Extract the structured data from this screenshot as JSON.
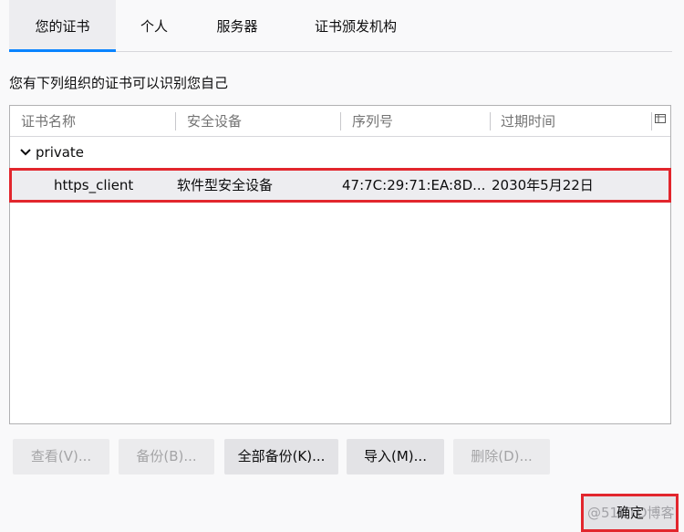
{
  "tabs": [
    {
      "label": "您的证书",
      "selected": true
    },
    {
      "label": "个人",
      "selected": false
    },
    {
      "label": "服务器",
      "selected": false
    },
    {
      "label": "证书颁发机构",
      "selected": false
    }
  ],
  "description": "您有下列组织的证书可以识别您自己",
  "table": {
    "columns": [
      "证书名称",
      "安全设备",
      "序列号",
      "过期时间"
    ],
    "column_picker_icon": "column-picker-icon",
    "group": {
      "label": "private",
      "expanded": true,
      "icon": "chevron-down-icon"
    },
    "rows": [
      {
        "name": "https_client",
        "device": "软件型安全设备",
        "serial": "47:7C:29:71:EA:8D...",
        "expires": "2030年5月22日"
      }
    ]
  },
  "buttons": {
    "view": "查看(V)...",
    "backup": "备份(B)...",
    "backup_all": "全部备份(K)...",
    "import": "导入(M)...",
    "delete": "删除(D)..."
  },
  "ok_button": "确定",
  "watermark": "@51CTO博客",
  "colors": {
    "accent": "#0a84ff",
    "highlight": "#e2262d",
    "disabled_text": "#a4a4a6"
  }
}
